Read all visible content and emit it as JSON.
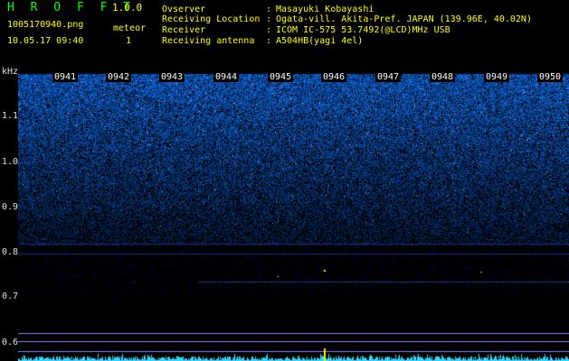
{
  "header": {
    "app_title": "H R O F F T",
    "app_version": "1.0.0",
    "filename": "1005170940.png",
    "timestamp": "10.05.17 09:40",
    "meteor_label": "meteor",
    "meteor_count": "1"
  },
  "info": [
    {
      "label": "Ovserver",
      "value": "Masayuki Kobayashi"
    },
    {
      "label": "Receiving Location",
      "value": "Ogata-vill. Akita-Pref. JAPAN (139.96E, 40.02N)"
    },
    {
      "label": "Receiver",
      "value": "ICOM IC-575 53.7492(@LCD)MHz USB"
    },
    {
      "label": "Receiving antenna",
      "value": "A504HB(yagi 4el)"
    }
  ],
  "info_separator": ":",
  "axis": {
    "unit_label": "kHz",
    "freq_ticks": [
      "1.1",
      "1.0",
      "0.9",
      "0.8",
      "0.7",
      "0.6"
    ],
    "time_ticks": [
      "0941",
      "0942",
      "0943",
      "0944",
      "0945",
      "0946",
      "0947",
      "0948",
      "0949",
      "0950"
    ]
  },
  "colors": {
    "green_text": "#00ff00",
    "white_text": "#ffffff",
    "yellow_text": "#ffff00",
    "axis_text": "#e0e0e0",
    "noise_blue": "#2a3cff",
    "carrier": "#4a60ff",
    "meteor": "#ffee00",
    "waveform": "#30d8ff",
    "ref_line": "#8080ff"
  },
  "events": {
    "meteor_times": [
      "0946"
    ]
  }
}
